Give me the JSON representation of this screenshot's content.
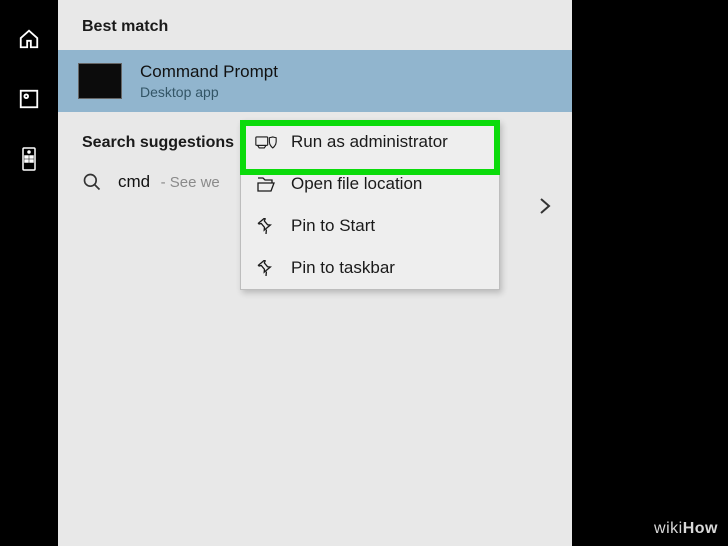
{
  "sidebar": {
    "icons": [
      "home-icon",
      "photo-icon",
      "remote-icon"
    ]
  },
  "header": {
    "best_match": "Best match"
  },
  "best_match": {
    "title": "Command Prompt",
    "subtitle": "Desktop app"
  },
  "search": {
    "header": "Search suggestions",
    "query": "cmd",
    "hint": "- See we"
  },
  "context_menu": {
    "items": [
      {
        "label": "Run as administrator",
        "icon": "admin-shield-icon"
      },
      {
        "label": "Open file location",
        "icon": "folder-open-icon"
      },
      {
        "label": "Pin to Start",
        "icon": "pin-start-icon"
      },
      {
        "label": "Pin to taskbar",
        "icon": "pin-taskbar-icon"
      }
    ]
  },
  "watermark": {
    "prefix": "wiki",
    "suffix": "How"
  }
}
